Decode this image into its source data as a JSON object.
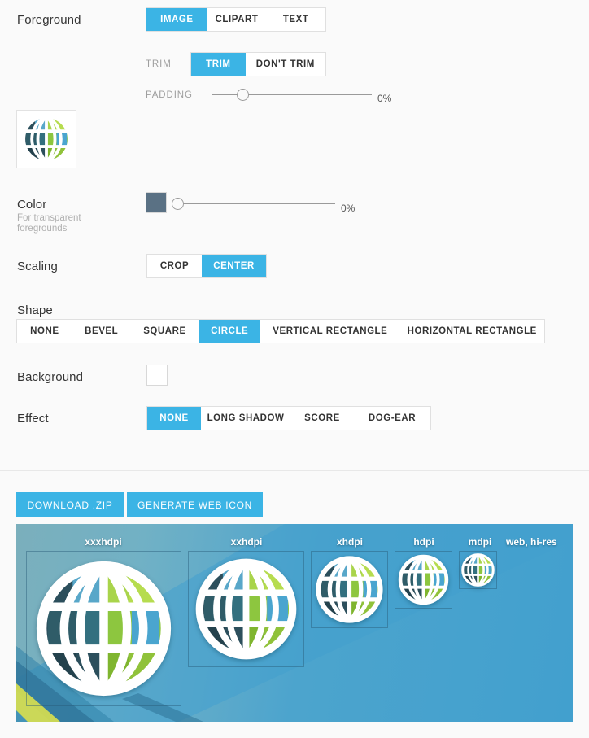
{
  "foreground": {
    "label": "Foreground",
    "options": [
      "IMAGE",
      "CLIPART",
      "TEXT"
    ],
    "selected": "IMAGE",
    "thumbnail_icon": "globe-icon"
  },
  "trim": {
    "caption": "TRIM",
    "options": [
      "TRIM",
      "DON'T TRIM"
    ],
    "selected": "TRIM"
  },
  "padding": {
    "caption": "PADDING",
    "value": "0%",
    "percent": 19
  },
  "color": {
    "label": "Color",
    "sublabel": "For transparent foregrounds",
    "swatch_hex": "#5a7184",
    "value": "0%",
    "percent": 2
  },
  "scaling": {
    "label": "Scaling",
    "options": [
      "CROP",
      "CENTER"
    ],
    "selected": "CENTER"
  },
  "shape": {
    "label": "Shape",
    "options": [
      "NONE",
      "BEVEL",
      "SQUARE",
      "CIRCLE",
      "VERTICAL RECTANGLE",
      "HORIZONTAL RECTANGLE"
    ],
    "selected": "CIRCLE"
  },
  "background": {
    "label": "Background",
    "swatch_hex": "#ffffff"
  },
  "effect": {
    "label": "Effect",
    "options": [
      "NONE",
      "LONG SHADOW",
      "SCORE",
      "DOG-EAR"
    ],
    "selected": "NONE"
  },
  "actions": {
    "download_label": "DOWNLOAD .ZIP",
    "generate_label": "GENERATE WEB ICON",
    "accent_hex": "#3bb4e5"
  },
  "preview": {
    "densities": [
      {
        "label": "xxxhdpi",
        "size": 192
      },
      {
        "label": "xxhdpi",
        "size": 144
      },
      {
        "label": "xhdpi",
        "size": 96
      },
      {
        "label": "hdpi",
        "size": 72
      },
      {
        "label": "mdpi",
        "size": 48
      },
      {
        "label": "web, hi-res",
        "size": 0
      }
    ],
    "icon": "globe-icon"
  }
}
